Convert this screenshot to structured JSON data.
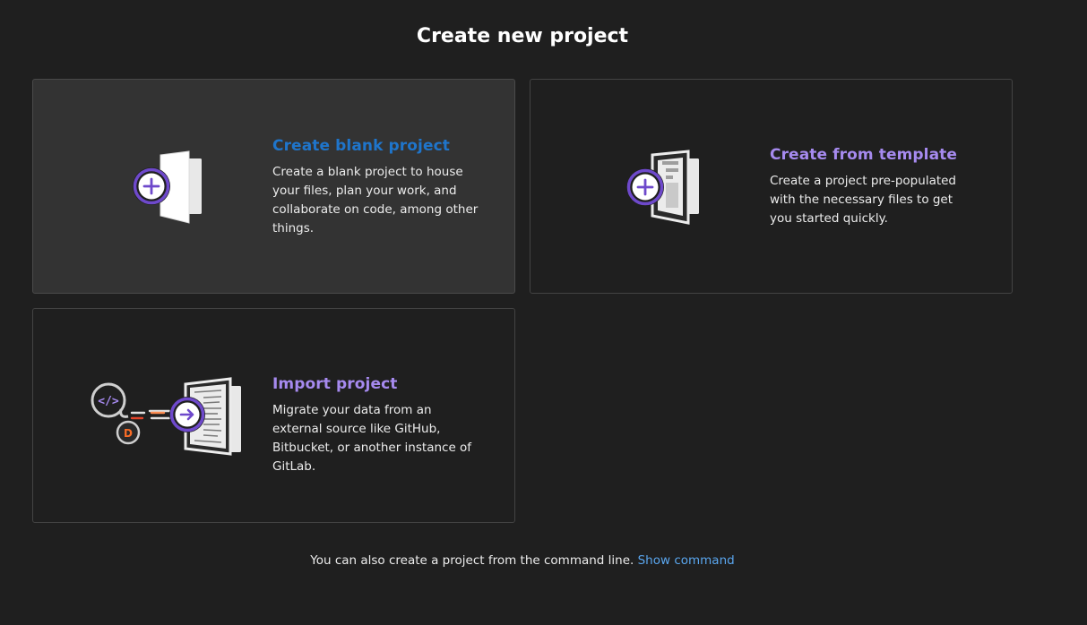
{
  "page": {
    "title": "Create new project"
  },
  "cards": {
    "blank": {
      "title": "Create blank project",
      "description": "Create a blank project to house your files, plan your work, and collaborate on code, among other things.",
      "icon": "blank-project-illustration"
    },
    "template": {
      "title": "Create from template",
      "description": "Create a project pre-populated with the necessary files to get you started quickly.",
      "icon": "template-project-illustration"
    },
    "import": {
      "title": "Import project",
      "description": "Migrate your data from an external source like GitHub, Bitbucket, or another instance of GitLab.",
      "icon": "import-project-illustration"
    }
  },
  "footer": {
    "text": "You can also create a project from the command line.",
    "link_label": "Show command"
  },
  "colors": {
    "background": "#1f1f1f",
    "card_hover": "#333333",
    "accent_purple": "#a68aef",
    "link_blue": "#1f75cb",
    "footer_link": "#5aa6ee"
  }
}
